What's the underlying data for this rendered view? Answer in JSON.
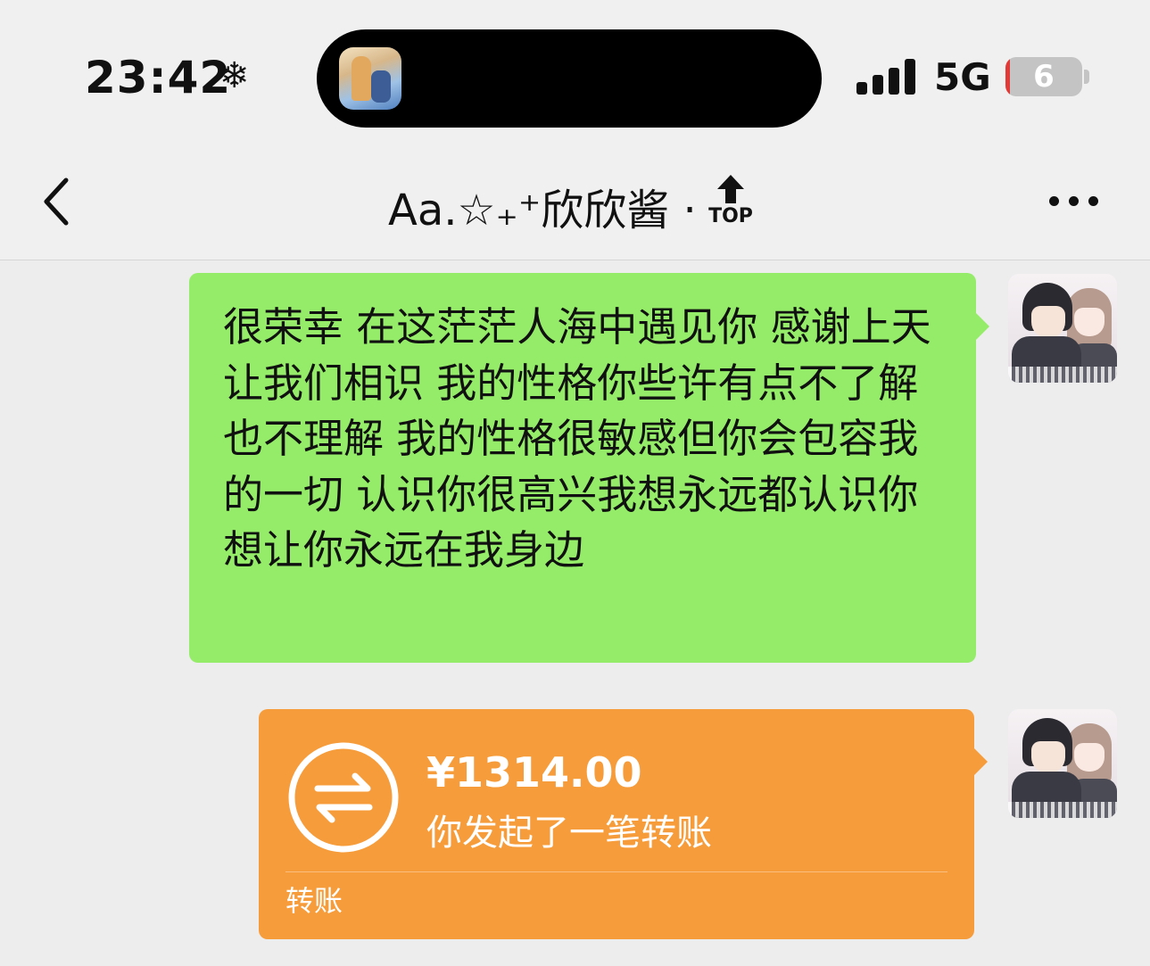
{
  "status_bar": {
    "time": "23:42",
    "weather_glyph": "❄",
    "network": "5G",
    "battery_level": "6",
    "battery_percent": 6,
    "signal_bars": 4
  },
  "nav_bar": {
    "title": "Aa.☆₊⁺欣欣酱 ·",
    "top_label": "TOP",
    "icons": [
      "back-chevron-icon",
      "top-arrow-icon",
      "more-dots-icon"
    ]
  },
  "messages": {
    "text_message": "很荣幸 在这茫茫人海中遇见你 感谢上天 让我们相识 我的性格你些许有点不了解也不理解 我的性格很敏感但你会包容我的一切  认识你很高兴我想永远都认识你想让你永远在我身边",
    "transfer": {
      "amount": "¥1314.00",
      "description": "你发起了一笔转账",
      "label": "转账",
      "icon": "transfer-arrows-icon"
    }
  },
  "colors": {
    "background": "#ededed",
    "bubble_green": "#95ec69",
    "bubble_orange": "#f79c3a",
    "battery_low": "#e23b37"
  }
}
